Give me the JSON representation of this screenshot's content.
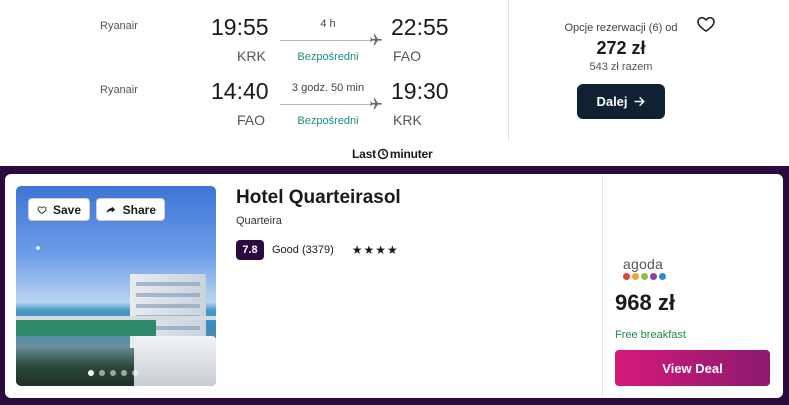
{
  "flight": {
    "legs": [
      {
        "airline": "Ryanair",
        "dep_time": "19:55",
        "arr_time": "22:55",
        "dep_airport": "KRK",
        "arr_airport": "FAO",
        "duration": "4 h",
        "stops": "Bezpośredni"
      },
      {
        "airline": "Ryanair",
        "dep_time": "14:40",
        "arr_time": "19:30",
        "dep_airport": "FAO",
        "arr_airport": "KRK",
        "duration": "3 godz. 50 min",
        "stops": "Bezpośredni"
      }
    ],
    "booking_options": "Opcje rezerwacji (6) od",
    "price": "272 zł",
    "total": "543 zł razem",
    "cta": "Dalej",
    "favorite_icon": "heart-outline-icon"
  },
  "promo": {
    "logo_left": "Last",
    "logo_right": "minuter"
  },
  "hotel": {
    "save_label": "Save",
    "share_label": "Share",
    "name": "Hotel Quarteirasol",
    "city": "Quarteira",
    "rating": "7.8",
    "rating_text": "Good (3379)",
    "stars": "★★★★",
    "provider": "agoda",
    "price": "968 zł",
    "perk": "Free breakfast",
    "cta": "View Deal",
    "photo_count": 5,
    "photo_index": 1,
    "colors": {
      "banner": "#2b0a3d",
      "accent_green": "#1e8a7c",
      "cta_start": "#d6197a",
      "cta_end": "#8a1a6e"
    }
  }
}
